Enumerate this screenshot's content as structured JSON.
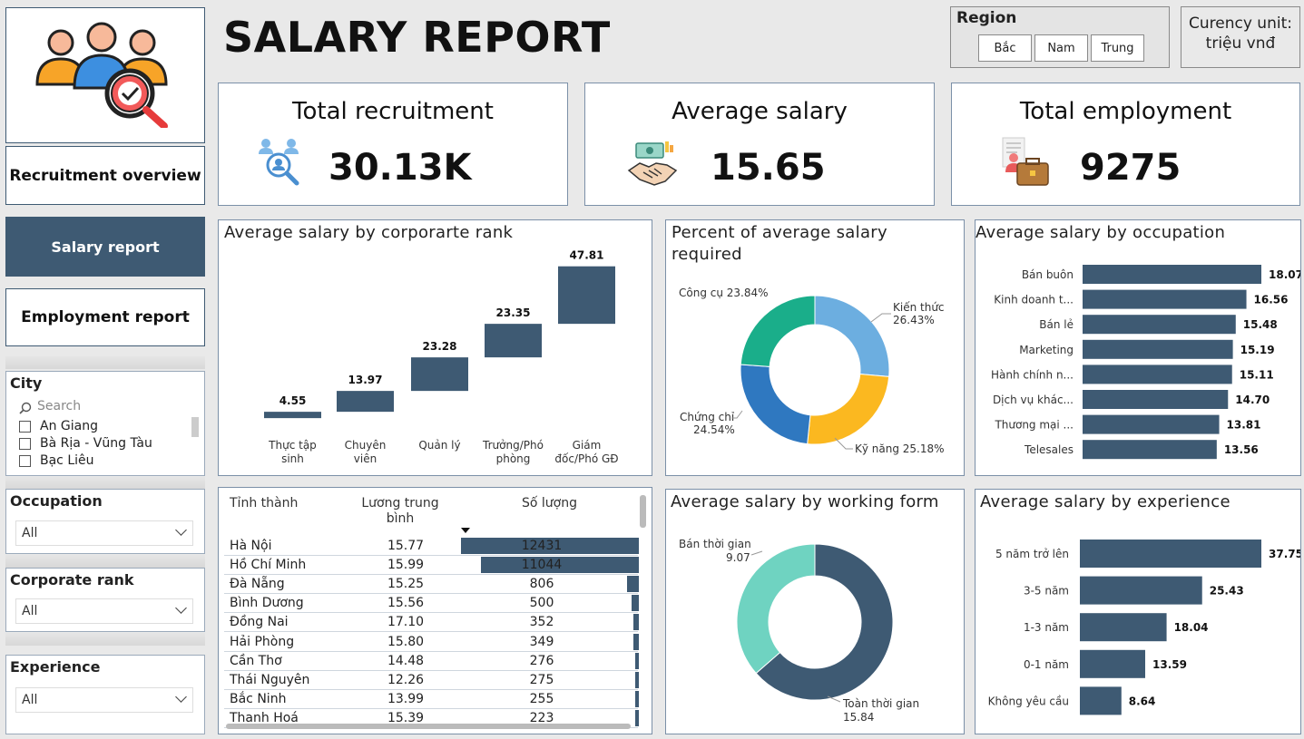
{
  "header": {
    "title": "SALARY REPORT"
  },
  "region": {
    "title": "Region",
    "options": [
      "Bắc",
      "Nam",
      "Trung"
    ]
  },
  "currency": {
    "line1": "Curency unit:",
    "line2": "triệu vnđ"
  },
  "nav": {
    "recruitment": "Recruitment overview",
    "salary": "Salary report",
    "employment": "Employment report"
  },
  "filters": {
    "city": {
      "title": "City",
      "search_placeholder": "Search",
      "items": [
        "An Giang",
        "Bà Rịa - Vũng Tàu",
        "Bạc Liêu"
      ]
    },
    "occupation": {
      "title": "Occupation",
      "value": "All"
    },
    "corporate_rank": {
      "title": "Corporate rank",
      "value": "All"
    },
    "experience": {
      "title": "Experience",
      "value": "All"
    }
  },
  "kpis": {
    "recruitment": {
      "title": "Total recruitment",
      "value": "30.13K"
    },
    "avg_salary": {
      "title": "Average salary",
      "value": "15.65"
    },
    "employment": {
      "title": "Total employment",
      "value": "9275"
    }
  },
  "charts": {
    "rank": {
      "title": "Average salary by corporarte rank"
    },
    "percent": {
      "title_line1": "Percent of average salary",
      "title_line2": "required"
    },
    "occupation": {
      "title": "Average salary by occupation"
    },
    "working_form": {
      "title": "Average salary by working form"
    },
    "experience": {
      "title": "Average salary by experience"
    }
  },
  "table": {
    "headers": [
      "Tỉnh thành",
      "Lương trung bình",
      "Số lượng"
    ],
    "header_line2": "bình",
    "rows": [
      [
        "Hà Nội",
        "15.77",
        "12431"
      ],
      [
        "Hồ Chí Minh",
        "15.99",
        "11044"
      ],
      [
        "Đà Nẵng",
        "15.25",
        "806"
      ],
      [
        "Bình Dương",
        "15.56",
        "500"
      ],
      [
        "Đồng Nai",
        "17.10",
        "352"
      ],
      [
        "Hải Phòng",
        "15.80",
        "349"
      ],
      [
        "Cần Thơ",
        "14.48",
        "276"
      ],
      [
        "Thái Nguyên",
        "12.26",
        "275"
      ],
      [
        "Bắc Ninh",
        "13.99",
        "255"
      ],
      [
        "Thanh Hoá",
        "15.39",
        "223"
      ]
    ]
  },
  "chart_data": [
    {
      "type": "bar",
      "title": "Average salary by corporarte rank",
      "categories": [
        "Thực tập sinh",
        "Chuyên viên",
        "Quản lý",
        "Trưởng/Phó phòng",
        "Giám đốc/Phó GĐ"
      ],
      "category_lines": [
        [
          "Thực tập",
          "sinh"
        ],
        [
          "Chuyên",
          "viên"
        ],
        [
          "Quản lý"
        ],
        [
          "Trưởng/Phó",
          "phòng"
        ],
        [
          "Giám",
          "đốc/Phó GĐ"
        ]
      ],
      "values": [
        4.55,
        13.97,
        23.28,
        23.35,
        47.81
      ],
      "color": "#3e5a73"
    },
    {
      "type": "pie",
      "title": "Percent of average salary required",
      "slices": [
        {
          "label": "Kiến thức",
          "value": 26.43,
          "pct": "26.43%",
          "color": "#6caee0"
        },
        {
          "label": "Kỹ năng",
          "value": 25.18,
          "pct": "25.18%",
          "color": "#fbb820"
        },
        {
          "label": "Chứng chỉ",
          "value": 24.54,
          "pct": "24.54%",
          "color": "#2f78c0"
        },
        {
          "label": "Công cụ",
          "value": 23.84,
          "pct": "23.84%",
          "color": "#1aae8a"
        }
      ]
    },
    {
      "type": "bar",
      "title": "Average salary by occupation",
      "categories": [
        "Bán buôn",
        "Kinh doanh t...",
        "Bán lẻ",
        "Marketing",
        "Hành chính n...",
        "Dịch vụ khác...",
        "Thương mại ...",
        "Telesales"
      ],
      "values": [
        18.07,
        16.56,
        15.48,
        15.19,
        15.11,
        14.7,
        13.81,
        13.56
      ],
      "labels": [
        "18.07",
        "16.56",
        "15.48",
        "15.19",
        "15.11",
        "14.70",
        "13.81",
        "13.56"
      ],
      "color": "#3e5a73"
    },
    {
      "type": "pie",
      "title": "Average salary by working form",
      "slices": [
        {
          "label": "Toàn thời gian",
          "value": 15.84,
          "color": "#3e5a73"
        },
        {
          "label": "Bán thời gian",
          "value": 9.07,
          "color": "#6fd3c1"
        }
      ]
    },
    {
      "type": "bar",
      "title": "Average salary by experience",
      "categories": [
        "5 năm trở lên",
        "3-5 năm",
        "1-3 năm",
        "0-1 năm",
        "Không yêu cầu"
      ],
      "values": [
        37.75,
        25.43,
        18.04,
        13.59,
        8.64
      ],
      "color": "#3e5a73"
    },
    {
      "type": "bar",
      "title": "Số lượng",
      "categories": [
        "Hà Nội",
        "Hồ Chí Minh",
        "Đà Nẵng",
        "Bình Dương",
        "Đồng Nai",
        "Hải Phòng",
        "Cần Thơ",
        "Thái Nguyên",
        "Bắc Ninh",
        "Thanh Hoá"
      ],
      "values": [
        12431,
        11044,
        806,
        500,
        352,
        349,
        276,
        275,
        255,
        223
      ],
      "color": "#3e5a73"
    }
  ]
}
